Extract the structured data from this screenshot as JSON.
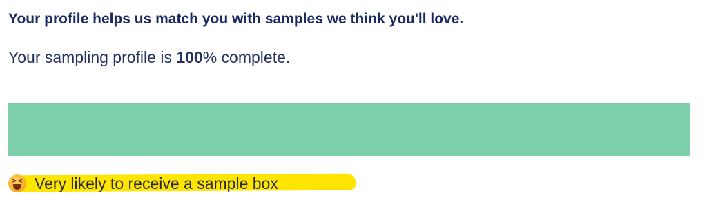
{
  "profile": {
    "heading": "Your profile helps us match you with samples we think you'll love.",
    "status_prefix": "Your sampling profile is ",
    "completion_value": "100",
    "completion_suffix": "% complete.",
    "progress_percent": 100,
    "likelihood_icon": "laughing-face-emoji",
    "likelihood_label": "Very likely to receive a sample box"
  },
  "colors": {
    "text": "#1c2a63",
    "progress_fill": "#7dcfab",
    "highlight": "#ffe600"
  }
}
